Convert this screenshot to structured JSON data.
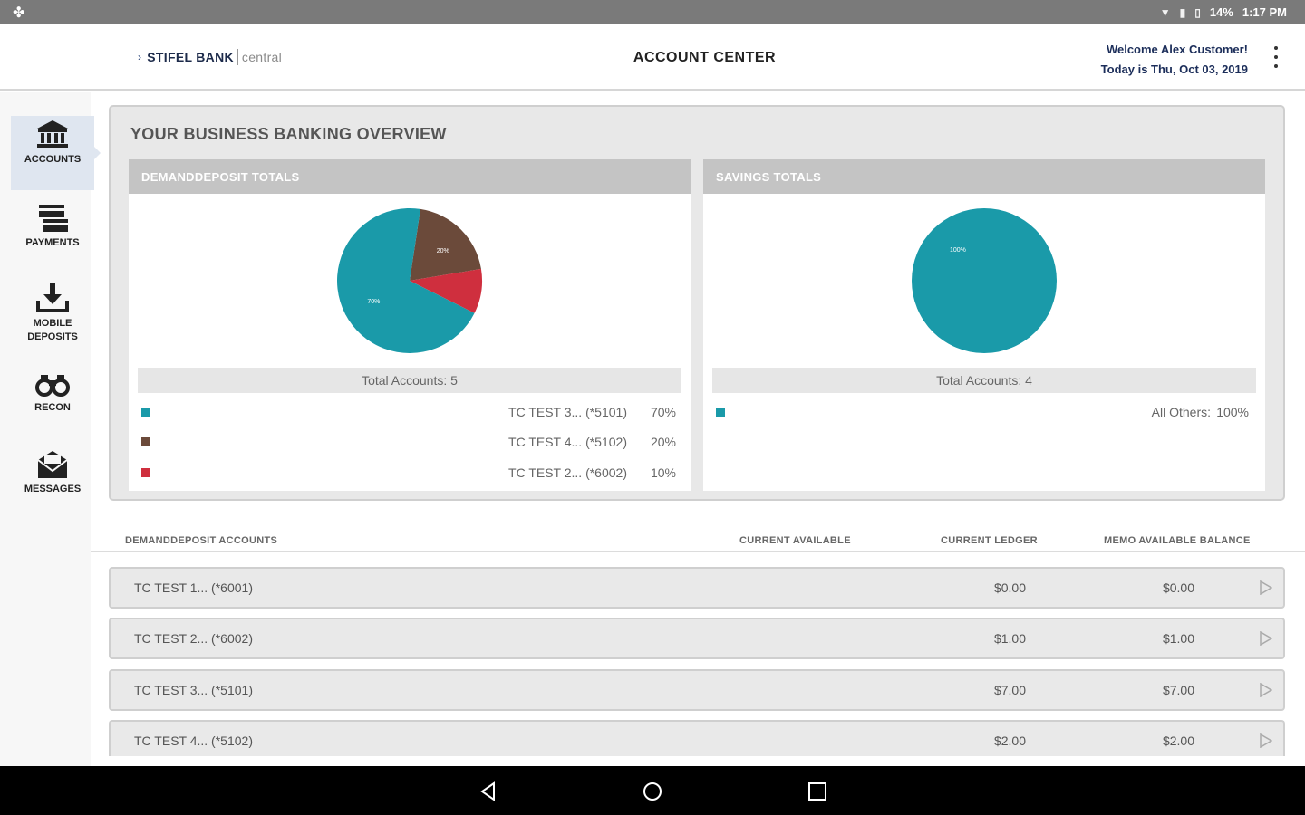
{
  "status_bar": {
    "battery": "14%",
    "time": "1:17 PM"
  },
  "header": {
    "logo_bank": "STIFEL BANK",
    "logo_central": "central",
    "title": "ACCOUNT CENTER",
    "welcome": "Welcome Alex Customer!",
    "date": "Today is Thu, Oct 03, 2019"
  },
  "sidebar": {
    "items": [
      {
        "label": "ACCOUNTS",
        "icon": "bank-icon",
        "active": true
      },
      {
        "label": "PAYMENTS",
        "icon": "payments-icon",
        "active": false
      },
      {
        "label": "MOBILE DEPOSITS",
        "icon": "download-icon",
        "active": false
      },
      {
        "label": "RECON",
        "icon": "binoculars-icon",
        "active": false
      },
      {
        "label": "MESSAGES",
        "icon": "envelope-icon",
        "active": false
      }
    ]
  },
  "overview": {
    "title": "YOUR BUSINESS BANKING OVERVIEW",
    "demand": {
      "header": "DEMANDDEPOSIT TOTALS",
      "total_label": "Total Accounts: 5",
      "slices": [
        {
          "name": "TC TEST 3... (*5101)",
          "pct_label": "70%",
          "value": 70,
          "color": "#1a9aa9"
        },
        {
          "name": "TC TEST 4... (*5102)",
          "pct_label": "20%",
          "value": 20,
          "color": "#6b4a3a"
        },
        {
          "name": "TC TEST 2... (*6002)",
          "pct_label": "10%",
          "value": 10,
          "color": "#cf2f3e"
        }
      ]
    },
    "savings": {
      "header": "SAVINGS TOTALS",
      "total_label": "Total Accounts: 4",
      "slices": [
        {
          "name": "All Others:",
          "pct_label": "100%",
          "value": 100,
          "color": "#1a9aa9"
        }
      ]
    }
  },
  "accounts_table": {
    "headers": {
      "account": "DEMANDDEPOSIT ACCOUNTS",
      "available": "CURRENT AVAILABLE",
      "ledger": "CURRENT LEDGER",
      "memo": "MEMO AVAILABLE BALANCE"
    },
    "rows": [
      {
        "name": "TC TEST 1... (*6001)",
        "ledger": "$0.00",
        "memo": "$0.00"
      },
      {
        "name": "TC TEST 2... (*6002)",
        "ledger": "$1.00",
        "memo": "$1.00"
      },
      {
        "name": "TC TEST 3... (*5101)",
        "ledger": "$7.00",
        "memo": "$7.00"
      },
      {
        "name": "TC TEST 4... (*5102)",
        "ledger": "$2.00",
        "memo": "$2.00"
      }
    ]
  }
}
